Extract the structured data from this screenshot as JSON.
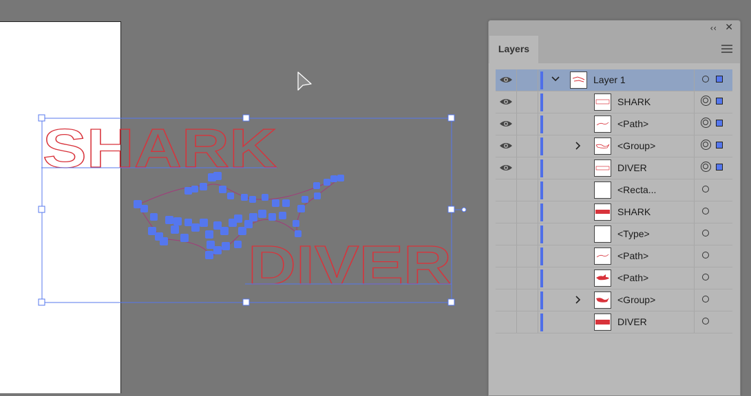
{
  "canvas": {
    "artwork_text_top": "SHARK",
    "artwork_text_bottom": "DIVER",
    "artwork_stroke_color": "#d8333b",
    "selection_color": "#5577ee"
  },
  "panel": {
    "tab_label": "Layers",
    "collapse_glyph": "‹‹",
    "close_glyph": "✕",
    "menu_icon": "hamburger-menu-icon"
  },
  "layers": [
    {
      "name": "Layer 1",
      "indent": 0,
      "visible": true,
      "expandable": true,
      "expanded": true,
      "selected": true,
      "target": "single",
      "has_selection": true,
      "thumb": "layer"
    },
    {
      "name": "SHARK",
      "indent": 1,
      "visible": true,
      "expandable": false,
      "target": "double",
      "has_selection": true,
      "thumb": "shark-outline"
    },
    {
      "name": "<Path>",
      "indent": 1,
      "visible": true,
      "expandable": false,
      "target": "double",
      "has_selection": true,
      "thumb": "path-outline"
    },
    {
      "name": "<Group>",
      "indent": 1,
      "visible": true,
      "expandable": true,
      "target": "double",
      "has_selection": true,
      "thumb": "group-outline"
    },
    {
      "name": "DIVER",
      "indent": 1,
      "visible": true,
      "expandable": false,
      "target": "double",
      "has_selection": true,
      "thumb": "diver-outline"
    },
    {
      "name": "<Recta...",
      "indent": 1,
      "visible": false,
      "expandable": false,
      "target": "single",
      "has_selection": false,
      "thumb": "blank"
    },
    {
      "name": "SHARK",
      "indent": 1,
      "visible": false,
      "expandable": false,
      "target": "single",
      "has_selection": false,
      "thumb": "shark-text"
    },
    {
      "name": "<Type>",
      "indent": 1,
      "visible": false,
      "expandable": false,
      "target": "single",
      "has_selection": false,
      "thumb": "blank"
    },
    {
      "name": "<Path>",
      "indent": 1,
      "visible": false,
      "expandable": false,
      "target": "single",
      "has_selection": false,
      "thumb": "path-outline"
    },
    {
      "name": "<Path>",
      "indent": 1,
      "visible": false,
      "expandable": false,
      "target": "single",
      "has_selection": false,
      "thumb": "shark-fill"
    },
    {
      "name": "<Group>",
      "indent": 1,
      "visible": false,
      "expandable": true,
      "target": "single",
      "has_selection": false,
      "thumb": "group-fill"
    },
    {
      "name": "DIVER",
      "indent": 1,
      "visible": false,
      "expandable": false,
      "target": "single",
      "has_selection": false,
      "thumb": "diver-text"
    }
  ]
}
